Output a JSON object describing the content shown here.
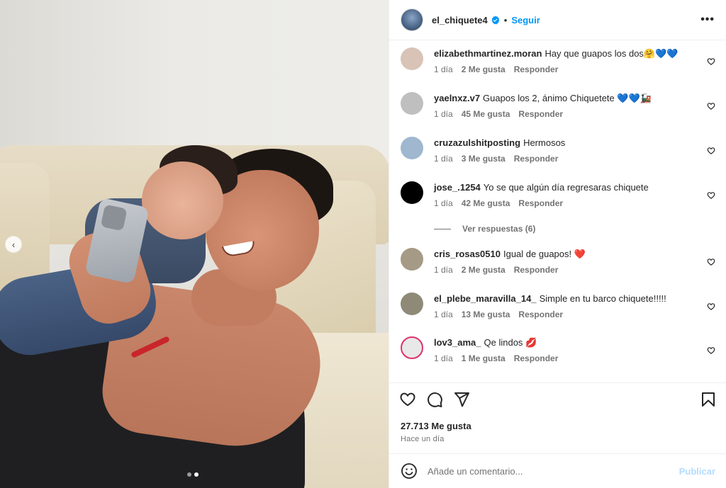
{
  "post": {
    "author": "el_chiquete4",
    "separator": "•",
    "follow_label": "Seguir",
    "more_icon": "more-horizontal-icon",
    "verified_color": "#0095f6"
  },
  "carousel": {
    "prev_icon": "‹",
    "slides": 2,
    "active_slide": 2
  },
  "comments": [
    {
      "user": "elizabethmartinez.moran",
      "text": "Hay que guapos los dos🤗💙💙",
      "time": "1 día",
      "likes": "2 Me gusta",
      "reply": "Responder",
      "avatar_color": "#d8c3b6"
    },
    {
      "user": "yaelnxz.v7",
      "text": "Guapos los 2, ánimo Chiquetete 💙💙🚂",
      "time": "1 día",
      "likes": "45 Me gusta",
      "reply": "Responder",
      "avatar_color": "#bfbfbf"
    },
    {
      "user": "cruzazulshitposting",
      "text": "Hermosos",
      "time": "1 día",
      "likes": "3 Me gusta",
      "reply": "Responder",
      "avatar_color": "#9fb7cf"
    },
    {
      "user": "jose_.1254",
      "text": "Yo se que algún día regresaras chiquete",
      "time": "1 día",
      "likes": "42 Me gusta",
      "reply": "Responder",
      "avatar_color": "#000000"
    },
    {
      "user": "cris_rosas0510",
      "text": "Igual de guapos! ❤️",
      "time": "1 día",
      "likes": "2 Me gusta",
      "reply": "Responder",
      "avatar_color": "#a59a85"
    },
    {
      "user": "el_plebe_maravilla_14_",
      "text": "Simple en tu barco chiquete!!!!!",
      "time": "1 día",
      "likes": "13 Me gusta",
      "reply": "Responder",
      "avatar_color": "#8f8a78"
    },
    {
      "user": "lov3_ama_",
      "text": "Qe lindos 💋",
      "time": "1 día",
      "likes": "1 Me gusta",
      "reply": "Responder",
      "avatar_color": "#e8e8e8"
    }
  ],
  "view_replies": "Ver respuestas (6)",
  "actions": {
    "like_icon": "heart-icon",
    "comment_icon": "comment-icon",
    "share_icon": "share-icon",
    "save_icon": "bookmark-icon"
  },
  "likes_count": "27.713 Me gusta",
  "time_ago": "Hace un día",
  "composer": {
    "placeholder": "Añade un comentario...",
    "post_label": "Publicar"
  }
}
